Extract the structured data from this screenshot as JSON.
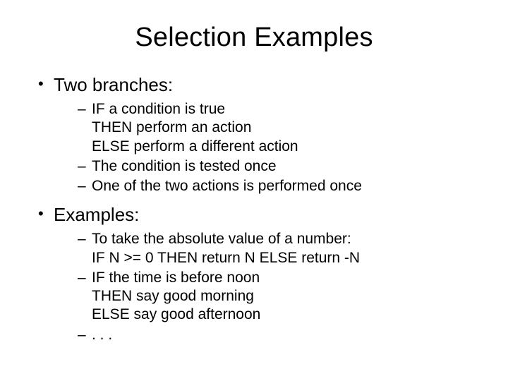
{
  "title": "Selection Examples",
  "sections": [
    {
      "label": "Two branches:",
      "items": [
        {
          "lines": [
            "IF a condition is true",
            "THEN perform an action",
            "ELSE perform a different action"
          ]
        },
        {
          "lines": [
            "The condition is tested once"
          ]
        },
        {
          "lines": [
            "One of the two actions is performed once"
          ]
        }
      ]
    },
    {
      "label": "Examples:",
      "items": [
        {
          "lines": [
            "To take the absolute value of a number:",
            "IF N >= 0 THEN return N ELSE return -N"
          ]
        },
        {
          "lines": [
            "IF the time is before noon",
            "THEN say good morning",
            "ELSE say good afternoon"
          ]
        },
        {
          "lines": [
            ". . ."
          ]
        }
      ]
    }
  ]
}
